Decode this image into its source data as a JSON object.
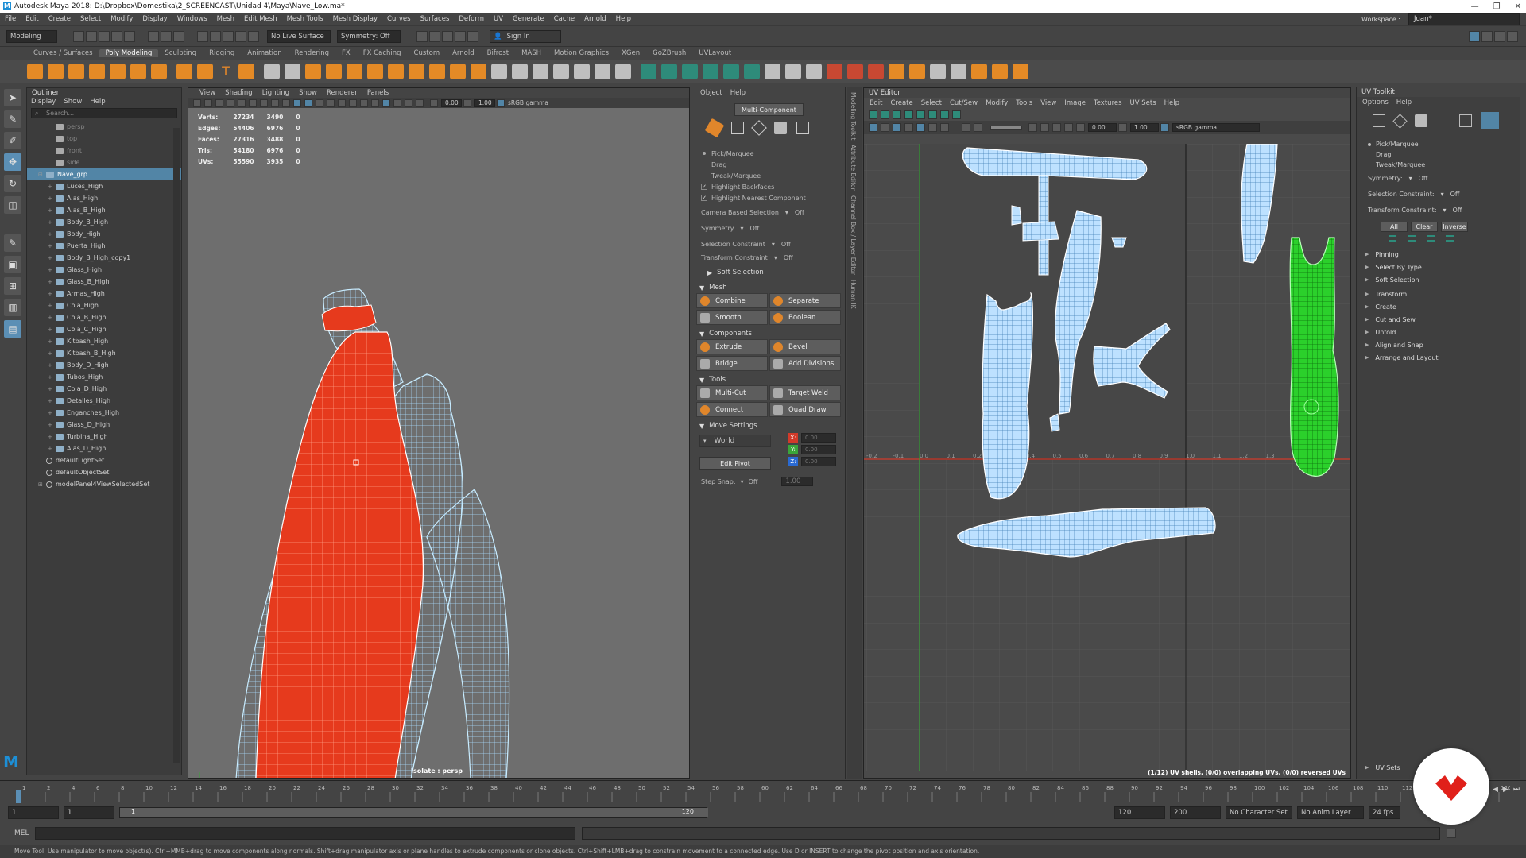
{
  "window": {
    "title": "Autodesk Maya 2018: D:\\Dropbox\\Domestika\\2_SCREENCAST\\Unidad 4\\Maya\\Nave_Low.ma*",
    "workspace_label": "Workspace :",
    "workspace_value": "Juan*"
  },
  "menubar": [
    "File",
    "Edit",
    "Create",
    "Select",
    "Modify",
    "Display",
    "Windows",
    "Mesh",
    "Edit Mesh",
    "Mesh Tools",
    "Mesh Display",
    "Curves",
    "Surfaces",
    "Deform",
    "UV",
    "Generate",
    "Cache",
    "Arnold",
    "Help"
  ],
  "statusline": {
    "mode": "Modeling",
    "live": "No Live Surface",
    "symmetry": "Symmetry: Off",
    "signin": "Sign In"
  },
  "shelftabs": [
    "Curves / Surfaces",
    "Poly Modeling",
    "Sculpting",
    "Rigging",
    "Animation",
    "Rendering",
    "FX",
    "FX Caching",
    "Custom",
    "Arnold",
    "Bifrost",
    "MASH",
    "Motion Graphics",
    "XGen",
    "GoZBrush",
    "UVLayout"
  ],
  "shelftab_active": "Poly Modeling",
  "outliner": {
    "title": "Outliner",
    "menu": [
      "Display",
      "Show",
      "Help"
    ],
    "search_placeholder": "Search...",
    "items": [
      {
        "label": "persp",
        "type": "cam",
        "indent": 1,
        "dim": true
      },
      {
        "label": "top",
        "type": "cam",
        "indent": 1,
        "dim": true
      },
      {
        "label": "front",
        "type": "cam",
        "indent": 1,
        "dim": true
      },
      {
        "label": "side",
        "type": "cam",
        "indent": 1,
        "dim": true
      },
      {
        "label": "Nave_grp",
        "type": "grp",
        "indent": 0,
        "sel": true,
        "tw": "⊟"
      },
      {
        "label": "Luces_High",
        "type": "mesh",
        "indent": 1,
        "tw": "+"
      },
      {
        "label": "Alas_High",
        "type": "mesh",
        "indent": 1,
        "tw": "+"
      },
      {
        "label": "Alas_B_High",
        "type": "mesh",
        "indent": 1,
        "tw": "+"
      },
      {
        "label": "Body_B_High",
        "type": "mesh",
        "indent": 1,
        "tw": "+"
      },
      {
        "label": "Body_High",
        "type": "mesh",
        "indent": 1,
        "tw": "+"
      },
      {
        "label": "Puerta_High",
        "type": "mesh",
        "indent": 1,
        "tw": "+"
      },
      {
        "label": "Body_B_High_copy1",
        "type": "mesh",
        "indent": 1,
        "tw": "+"
      },
      {
        "label": "Glass_High",
        "type": "mesh",
        "indent": 1,
        "tw": "+"
      },
      {
        "label": "Glass_B_High",
        "type": "mesh",
        "indent": 1,
        "tw": "+"
      },
      {
        "label": "Armas_High",
        "type": "mesh",
        "indent": 1,
        "tw": "+"
      },
      {
        "label": "Cola_High",
        "type": "mesh",
        "indent": 1,
        "tw": "+"
      },
      {
        "label": "Cola_B_High",
        "type": "mesh",
        "indent": 1,
        "tw": "+"
      },
      {
        "label": "Cola_C_High",
        "type": "mesh",
        "indent": 1,
        "tw": "+"
      },
      {
        "label": "Kitbash_High",
        "type": "mesh",
        "indent": 1,
        "tw": "+"
      },
      {
        "label": "Kitbash_B_High",
        "type": "mesh",
        "indent": 1,
        "tw": "+"
      },
      {
        "label": "Body_D_High",
        "type": "mesh",
        "indent": 1,
        "tw": "+"
      },
      {
        "label": "Tubos_High",
        "type": "mesh",
        "indent": 1,
        "tw": "+"
      },
      {
        "label": "Cola_D_High",
        "type": "mesh",
        "indent": 1,
        "tw": "+"
      },
      {
        "label": "Detalles_High",
        "type": "mesh",
        "indent": 1,
        "tw": "+"
      },
      {
        "label": "Enganches_High",
        "type": "mesh",
        "indent": 1,
        "tw": "+"
      },
      {
        "label": "Glass_D_High",
        "type": "mesh",
        "indent": 1,
        "tw": "+"
      },
      {
        "label": "Turbina_High",
        "type": "mesh",
        "indent": 1,
        "tw": "+"
      },
      {
        "label": "Alas_D_High",
        "type": "mesh",
        "indent": 1,
        "tw": "+"
      },
      {
        "label": "defaultLightSet",
        "type": "set",
        "indent": 0
      },
      {
        "label": "defaultObjectSet",
        "type": "set",
        "indent": 0
      },
      {
        "label": "modelPanel4ViewSelectedSet",
        "type": "set",
        "indent": 0,
        "tw": "⊞"
      }
    ]
  },
  "viewport": {
    "menu": [
      "View",
      "Shading",
      "Lighting",
      "Show",
      "Renderer",
      "Panels"
    ],
    "exposure": "0.00",
    "gamma": "1.00",
    "colorspace": "sRGB gamma",
    "hud": [
      [
        "Verts:",
        "27234",
        "3490",
        "0"
      ],
      [
        "Edges:",
        "54406",
        "6976",
        "0"
      ],
      [
        "Faces:",
        "27316",
        "3488",
        "0"
      ],
      [
        "Tris:",
        "54180",
        "6976",
        "0"
      ],
      [
        "UVs:",
        "55590",
        "3935",
        "0"
      ]
    ],
    "camera_label": "Isolate : persp"
  },
  "modeling_toolkit": {
    "menu": [
      "Object",
      "Help"
    ],
    "multi_component": "Multi-Component",
    "select_modes": [
      {
        "label": "Pick/Marquee",
        "kind": "dot"
      },
      {
        "label": "Drag",
        "kind": "none"
      },
      {
        "label": "Tweak/Marquee",
        "kind": "none"
      },
      {
        "label": "Highlight Backfaces",
        "kind": "check"
      },
      {
        "label": "Highlight Nearest Component",
        "kind": "check"
      }
    ],
    "camera_based": "Camera Based Selection",
    "camera_based_val": "Off",
    "symmetry": "Symmetry",
    "symmetry_val": "Off",
    "sel_constraint": "Selection Constraint",
    "sel_constraint_val": "Off",
    "xf_constraint": "Transform Constraint",
    "xf_constraint_val": "Off",
    "soft_selection": "Soft Selection",
    "mesh_header": "Mesh",
    "mesh_buttons": [
      "Combine",
      "Separate",
      "Smooth",
      "Boolean"
    ],
    "components_header": "Components",
    "component_buttons": [
      "Extrude",
      "Bevel",
      "Bridge",
      "Add Divisions"
    ],
    "tools_header": "Tools",
    "tool_buttons": [
      "Multi-Cut",
      "Target Weld",
      "Connect",
      "Quad Draw"
    ],
    "move_header": "Move Settings",
    "move_space": "World",
    "axes": [
      {
        "label": "X:",
        "color": "#d23a2a",
        "val": "0.00"
      },
      {
        "label": "Y:",
        "color": "#3aa53a",
        "val": "0.00"
      },
      {
        "label": "Z:",
        "color": "#2a6ad2",
        "val": "0.00"
      }
    ],
    "edit_pivot": "Edit Pivot",
    "step_snap": "Step Snap:",
    "step_snap_val": "Off",
    "step_snap_num": "1.00"
  },
  "side_tabs": [
    "Modeling Toolkit",
    "Attribute Editor",
    "Channel Box / Layer Editor",
    "Human IK"
  ],
  "uv_editor": {
    "title": "UV Editor",
    "menu": [
      "Edit",
      "Create",
      "Select",
      "Cut/Sew",
      "Modify",
      "Tools",
      "View",
      "Image",
      "Textures",
      "UV Sets",
      "Help"
    ],
    "exposure": "0.00",
    "gamma": "1.00",
    "colorspace": "sRGB gamma",
    "status": "(1/12) UV shells, (0/0) overlapping UVs, (0/0) reversed UVs",
    "axis_ticks": [
      "-0.2",
      "-0.1",
      "0.0",
      "0.1",
      "0.2",
      "0.3",
      "0.4",
      "0.5",
      "0.6",
      "0.7",
      "0.8",
      "0.9",
      "1.0",
      "1.1",
      "1.2",
      "1.3",
      "1.4",
      "1.5"
    ]
  },
  "uv_toolkit": {
    "title": "UV Toolkit",
    "menu": [
      "Options",
      "Help"
    ],
    "modes": [
      "Pick/Marquee",
      "Drag",
      "Tweak/Marquee"
    ],
    "symmetry": "Symmetry:",
    "symmetry_val": "Off",
    "sel_constraint": "Selection Constraint:",
    "sel_constraint_val": "Off",
    "xf_constraint": "Transform Constraint:",
    "xf_constraint_val": "Off",
    "buttons": [
      "All",
      "Clear",
      "Inverse"
    ],
    "sections_a": [
      "Pinning",
      "Select By Type",
      "Soft Selection"
    ],
    "sections_b": [
      "Transform",
      "Create",
      "Cut and Sew",
      "Unfold",
      "Align and Snap",
      "Arrange and Layout"
    ],
    "uvsets": "UV Sets"
  },
  "timeline": {
    "ticks": [
      "1",
      "2",
      "4",
      "6",
      "8",
      "10",
      "12",
      "14",
      "16",
      "18",
      "20",
      "22",
      "24",
      "26",
      "28",
      "30",
      "32",
      "34",
      "36",
      "38",
      "40",
      "42",
      "44",
      "46",
      "48",
      "50",
      "52",
      "54",
      "56",
      "58",
      "60",
      "62",
      "64",
      "66",
      "68",
      "70",
      "72",
      "74",
      "76",
      "78",
      "80",
      "82",
      "84",
      "86",
      "88",
      "90",
      "92",
      "94",
      "96",
      "98",
      "100",
      "102",
      "104",
      "106",
      "108",
      "110",
      "112",
      "114",
      "116",
      "118",
      "120"
    ],
    "current": "1",
    "start": "1",
    "start2": "1",
    "range_start": "1",
    "range_end": "120",
    "end": "120",
    "end2": "200",
    "character": "No Character Set",
    "anim_layer": "No Anim Layer",
    "fps": "24 fps"
  },
  "cmdline": {
    "lang": "MEL"
  },
  "helpline": "Move Tool: Use manipulator to move object(s). Ctrl+MMB+drag to move components along normals. Shift+drag manipulator axis or plane handles to extrude components or clone objects. Ctrl+Shift+LMB+drag to constrain movement to a connected edge. Use D or INSERT to change the pivot position and axis orientation.",
  "colors": {
    "accent": "#5285a6",
    "orange": "#e0862b",
    "wire": "#9fd3ff",
    "selected": "#e63a1d",
    "uvsel": "#22cc22",
    "logo_red": "#e0201a"
  }
}
